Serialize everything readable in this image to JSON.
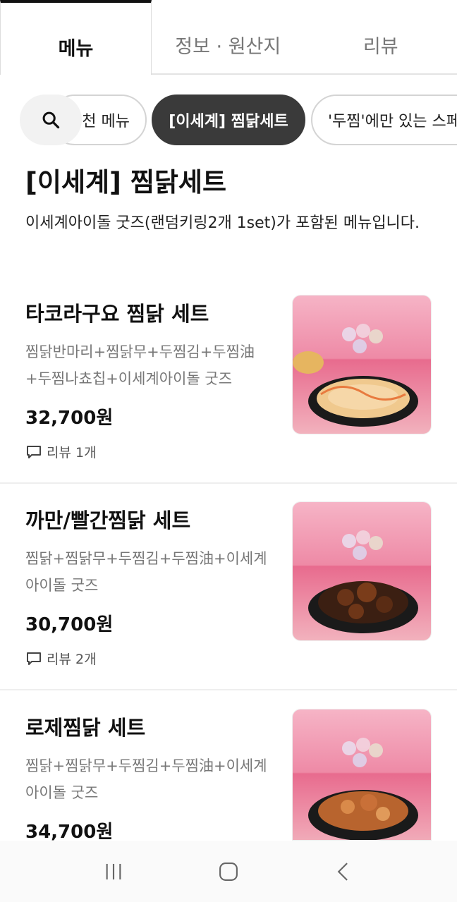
{
  "tabs": [
    {
      "label": "메뉴"
    },
    {
      "label": "정보 · 원산지"
    },
    {
      "label": "리뷰"
    }
  ],
  "chips": [
    {
      "label": "천 메뉴"
    },
    {
      "label": "[이세계] 찜닭세트"
    },
    {
      "label": "'두찜'에만 있는 스페"
    }
  ],
  "section": {
    "title": "[이세계] 찜닭세트",
    "description": "이세계아이돌 굿즈(랜덤키링2개 1set)가 포함된 메뉴입니다."
  },
  "items": [
    {
      "name": "타코라구요 찜닭 세트",
      "description": "찜닭반마리+찜닭무+두찜김+두찜油+두찜나쵸칩+이세계아이돌 굿즈",
      "price": "32,700원",
      "review": "리뷰 1개"
    },
    {
      "name": "까만/빨간찜닭 세트",
      "description": "찜닭+찜닭무+두찜김+두찜油+이세계아이돌 굿즈",
      "price": "30,700원",
      "review": "리뷰 2개"
    },
    {
      "name": "로제찜닭 세트",
      "description": "찜닭+찜닭무+두찜김+두찜油+이세계아이돌 굿즈",
      "price": "34,700원"
    }
  ],
  "colors": {
    "active_chip": "#3a3a3a",
    "thumb_pink": "#f0a0b4"
  }
}
